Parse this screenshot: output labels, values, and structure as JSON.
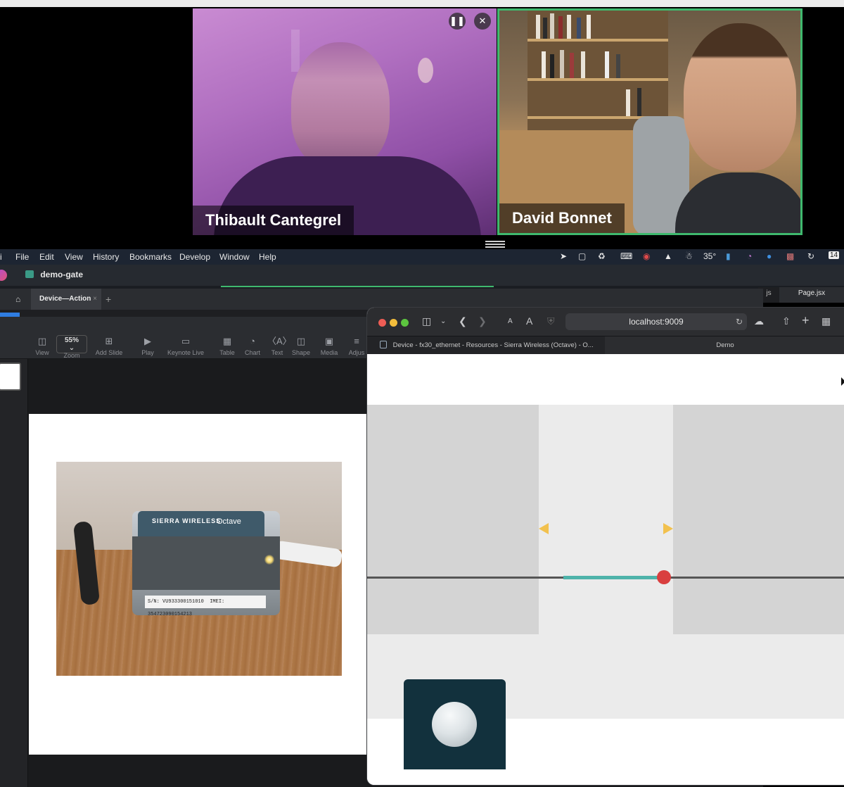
{
  "call": {
    "participants": [
      {
        "name": "Thibault Cantegrel"
      },
      {
        "name": "David Bonnet"
      }
    ],
    "controls": {
      "pause_icon": "pause-icon",
      "close_icon": "close-icon"
    }
  },
  "menubar": {
    "app": "i",
    "items": [
      "File",
      "Edit",
      "View",
      "History",
      "Bookmarks",
      "Develop",
      "Window",
      "Help"
    ],
    "temperature": "35°",
    "date_badge": "14"
  },
  "appbar": {
    "project": "demo-gate"
  },
  "keynote": {
    "tab_label": "Device—Action",
    "toolbar": [
      {
        "label": "View",
        "icon": "view-icon"
      },
      {
        "label": "Zoom",
        "value": "55%",
        "icon": "zoom-icon"
      },
      {
        "label": "Add Slide",
        "icon": "add-slide-icon"
      },
      {
        "label": "Play",
        "icon": "play-icon"
      },
      {
        "label": "Keynote Live",
        "icon": "keynote-live-icon"
      },
      {
        "label": "Table",
        "icon": "table-icon"
      },
      {
        "label": "Chart",
        "icon": "chart-icon"
      },
      {
        "label": "Text",
        "icon": "text-icon"
      },
      {
        "label": "Shape",
        "icon": "shape-icon"
      },
      {
        "label": "Media",
        "icon": "media-icon"
      },
      {
        "label": "Adjus",
        "icon": "adjust-icon"
      }
    ],
    "photo": {
      "brand": "SIERRA WIRELESS",
      "product": "Octave",
      "serial": "S/N: VU933300151010",
      "imei": "IMEI: 354723090154213"
    }
  },
  "ide": {
    "tab_js": "js",
    "tab_page": "Page.jsx"
  },
  "safari": {
    "url": "localhost:9009",
    "tabs": [
      {
        "title": "Device - fx30_ethernet - Resources - Sierra Wireless (Octave) - O...",
        "active": false
      },
      {
        "title": "Demo",
        "active": true
      }
    ],
    "demo": {
      "slider_value_pct": 62,
      "fill_start_pct": 41
    },
    "colors": {
      "accent": "#4eb3aa",
      "knob": "#d93f3f",
      "arrow": "#f2c14e",
      "card": "#12313d"
    }
  }
}
